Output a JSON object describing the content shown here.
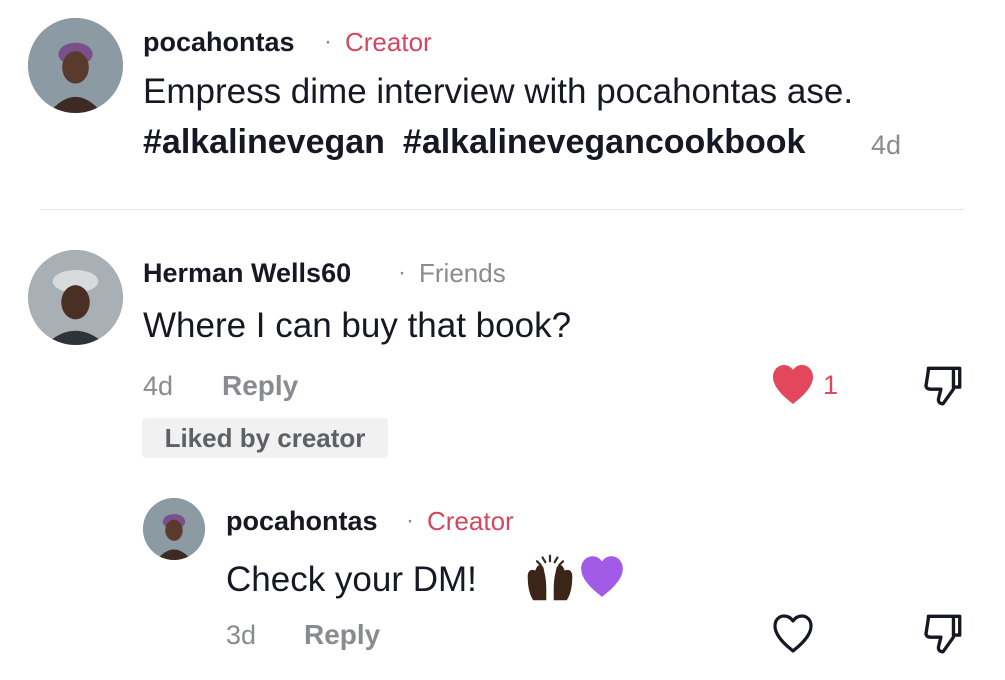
{
  "post": {
    "author": "pocahontas",
    "role": "Creator",
    "separator": "·",
    "text": "Empress dime interview with pocahontas ase.",
    "hashtags": [
      "#alkalinevegan",
      "#alkalinevegancookbook"
    ],
    "age": "4d"
  },
  "comment": {
    "author": "Herman Wells60",
    "relation": "Friends",
    "separator": "·",
    "text": "Where I can buy that book?",
    "age": "4d",
    "reply_label": "Reply",
    "likes": "1",
    "liked": true,
    "badge": "Liked by creator"
  },
  "reply": {
    "author": "pocahontas",
    "role": "Creator",
    "separator": "·",
    "text": "Check your DM!",
    "age": "3d",
    "reply_label": "Reply",
    "liked": false
  },
  "icons": {
    "like_filled": "heart-filled-icon",
    "like_outline": "heart-outline-icon",
    "dislike": "thumbs-down-icon"
  },
  "colors": {
    "creator_tag": "#d4475f",
    "heart": "#e3475c",
    "muted": "#8a8b91"
  }
}
